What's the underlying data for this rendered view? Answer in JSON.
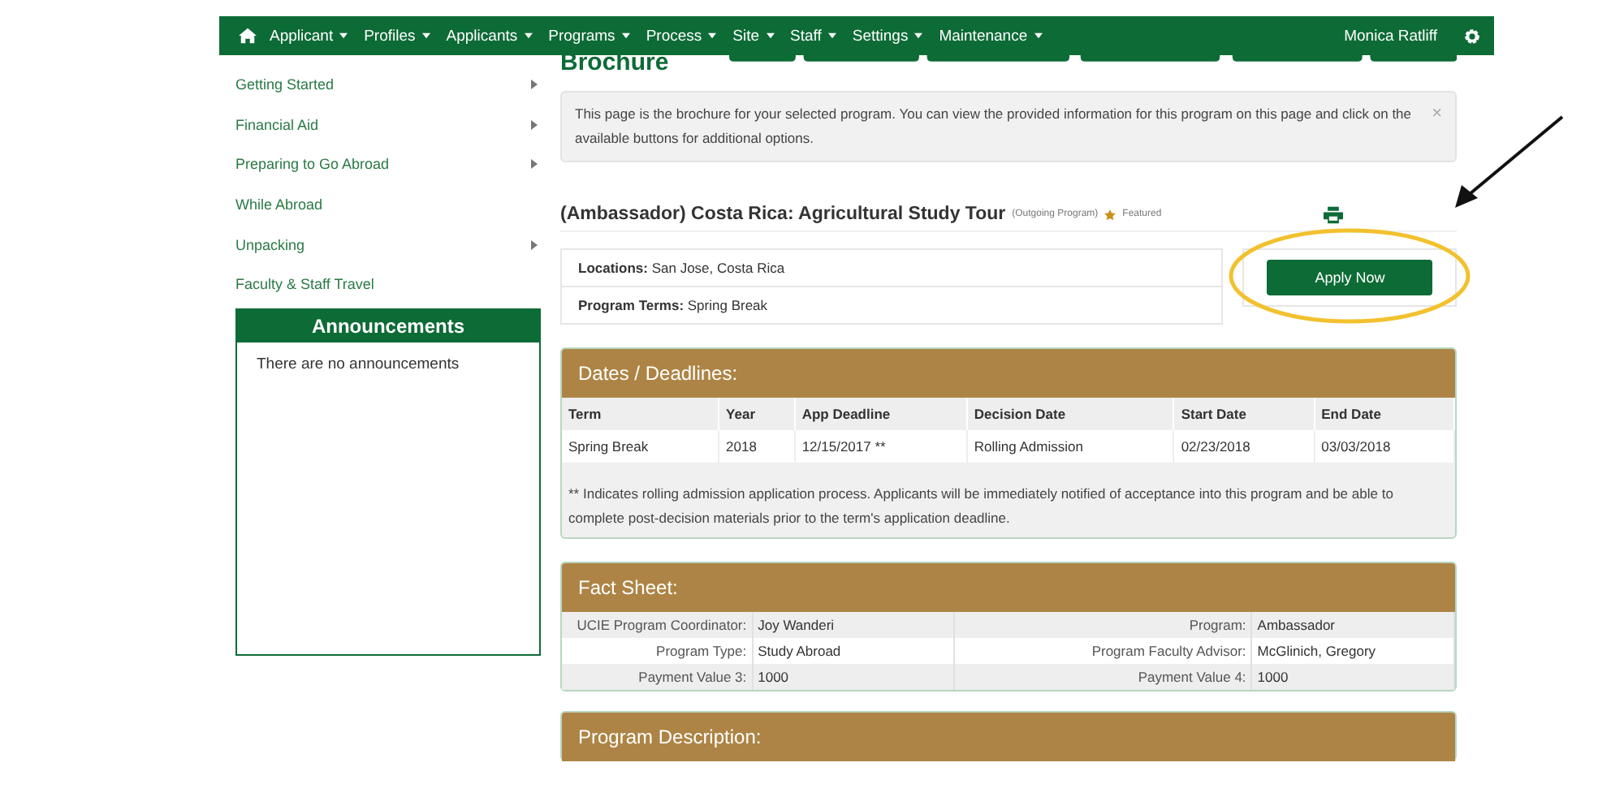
{
  "nav": {
    "items": [
      {
        "label": "Applicant",
        "dropdown": true
      },
      {
        "label": "Profiles",
        "dropdown": true
      },
      {
        "label": "Applicants",
        "dropdown": true
      },
      {
        "label": "Programs",
        "dropdown": true
      },
      {
        "label": "Process",
        "dropdown": true
      },
      {
        "label": "Site",
        "dropdown": true
      },
      {
        "label": "Staff",
        "dropdown": true
      },
      {
        "label": "Settings",
        "dropdown": true
      },
      {
        "label": "Maintenance",
        "dropdown": true
      }
    ],
    "user": "Monica Ratliff"
  },
  "sidebar": {
    "items": [
      {
        "label": "Getting Started",
        "has_submenu": true
      },
      {
        "label": "Financial Aid",
        "has_submenu": true
      },
      {
        "label": "Preparing to Go Abroad",
        "has_submenu": true
      },
      {
        "label": "While Abroad",
        "has_submenu": false
      },
      {
        "label": "Unpacking",
        "has_submenu": true
      },
      {
        "label": "Faculty & Staff Travel",
        "has_submenu": false
      }
    ],
    "announcements": {
      "title": "Announcements",
      "message": "There are no announcements"
    }
  },
  "page": {
    "title": "Brochure",
    "alert": "This page is the brochure for your selected program. You can view the provided information for this program on this page and click on the available buttons for additional options.",
    "alert_close": "×",
    "program_title": "(Ambassador) Costa Rica: Agricultural Study Tour",
    "program_type": "(Outgoing Program)",
    "featured": "Featured",
    "info": [
      {
        "label": "Locations:",
        "value": "San Jose, Costa Rica"
      },
      {
        "label": "Program Terms:",
        "value": "Spring Break"
      }
    ],
    "apply_button": "Apply Now"
  },
  "dates": {
    "title": "Dates / Deadlines:",
    "columns": [
      "Term",
      "Year",
      "App Deadline",
      "Decision Date",
      "Start Date",
      "End Date"
    ],
    "rows": [
      [
        "Spring Break",
        "2018",
        "12/15/2017 **",
        "Rolling Admission",
        "02/23/2018",
        "03/03/2018"
      ]
    ],
    "note": "** Indicates rolling admission application process. Applicants will be immediately notified of acceptance into this program and be able to complete post-decision materials prior to the term's application deadline."
  },
  "fact_sheet": {
    "title": "Fact Sheet:",
    "rows": [
      [
        {
          "label": "UCIE Program Coordinator:",
          "value": "Joy Wanderi"
        },
        {
          "label": "Program:",
          "value": "Ambassador"
        }
      ],
      [
        {
          "label": "Program Type:",
          "value": "Study Abroad"
        },
        {
          "label": "Program Faculty Advisor:",
          "value": "McGlinich, Gregory"
        }
      ],
      [
        {
          "label": "Payment Value 3:",
          "value": "1000"
        },
        {
          "label": "Payment Value 4:",
          "value": "1000"
        }
      ]
    ]
  },
  "description": {
    "title": "Program Description:"
  }
}
